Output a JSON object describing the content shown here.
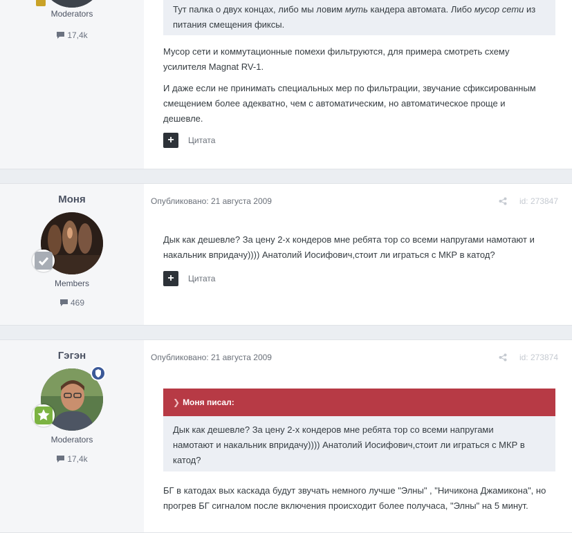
{
  "posts": [
    {
      "author": {
        "group": "Moderators",
        "post_count": "17,4k"
      },
      "quote_tail": {
        "line1_a": "Тут палка о двух концах, либо мы ловим ",
        "line1_em1": "муть",
        "line1_b": " кандера автомата. Либо ",
        "line1_em2": "мусор сети",
        "line1_c": " из",
        "line2": "питания смещения фиксы."
      },
      "paragraphs": [
        [
          "Мусор сети и коммутационные помехи фильтруются, для примера смотреть схему",
          "усилителя Magnat RV-1."
        ],
        [
          "И даже если не принимать специальных мер по фильтрации, звучание сфиксированным",
          "смещением более адекватно, чем с автоматическим, но автоматическое проще и",
          "дешевле."
        ]
      ],
      "quote_label": "Цитата"
    },
    {
      "author": {
        "name": "Моня",
        "group": "Members",
        "post_count": "469"
      },
      "published": "Опубликовано: 21 августа 2009",
      "post_id": "id: 273847",
      "paragraphs": [
        [
          "Дык как дешевле? За цену 2-х кондеров мне ребята тор со всеми напругами намотают и",
          "накальник впридачу)))) Анатолий Иосифович,стоит ли играться с МКР в катод?"
        ]
      ],
      "quote_label": "Цитата"
    },
    {
      "author": {
        "name": "Гэгэн",
        "group": "Moderators",
        "post_count": "17,4k"
      },
      "published": "Опубликовано: 21 августа 2009",
      "post_id": "id: 273874",
      "quote_header": "Моня писал:",
      "quote_lines": [
        "Дык как дешевле? За цену 2-х кондеров мне ребята тор со всеми напругами",
        "намотают и накальник впридачу)))) Анатолий Иосифович,стоит ли играться с МКР в",
        "катод?"
      ],
      "paragraphs": [
        [
          "БГ в катодах вых каскада будут звучать немного лучше \"Элны\" , \"Ничикона Джамикона\", но",
          "прогрев БГ сигналом после включения происходит более получаса, \"Элны\" на 5 минут."
        ]
      ]
    }
  ]
}
